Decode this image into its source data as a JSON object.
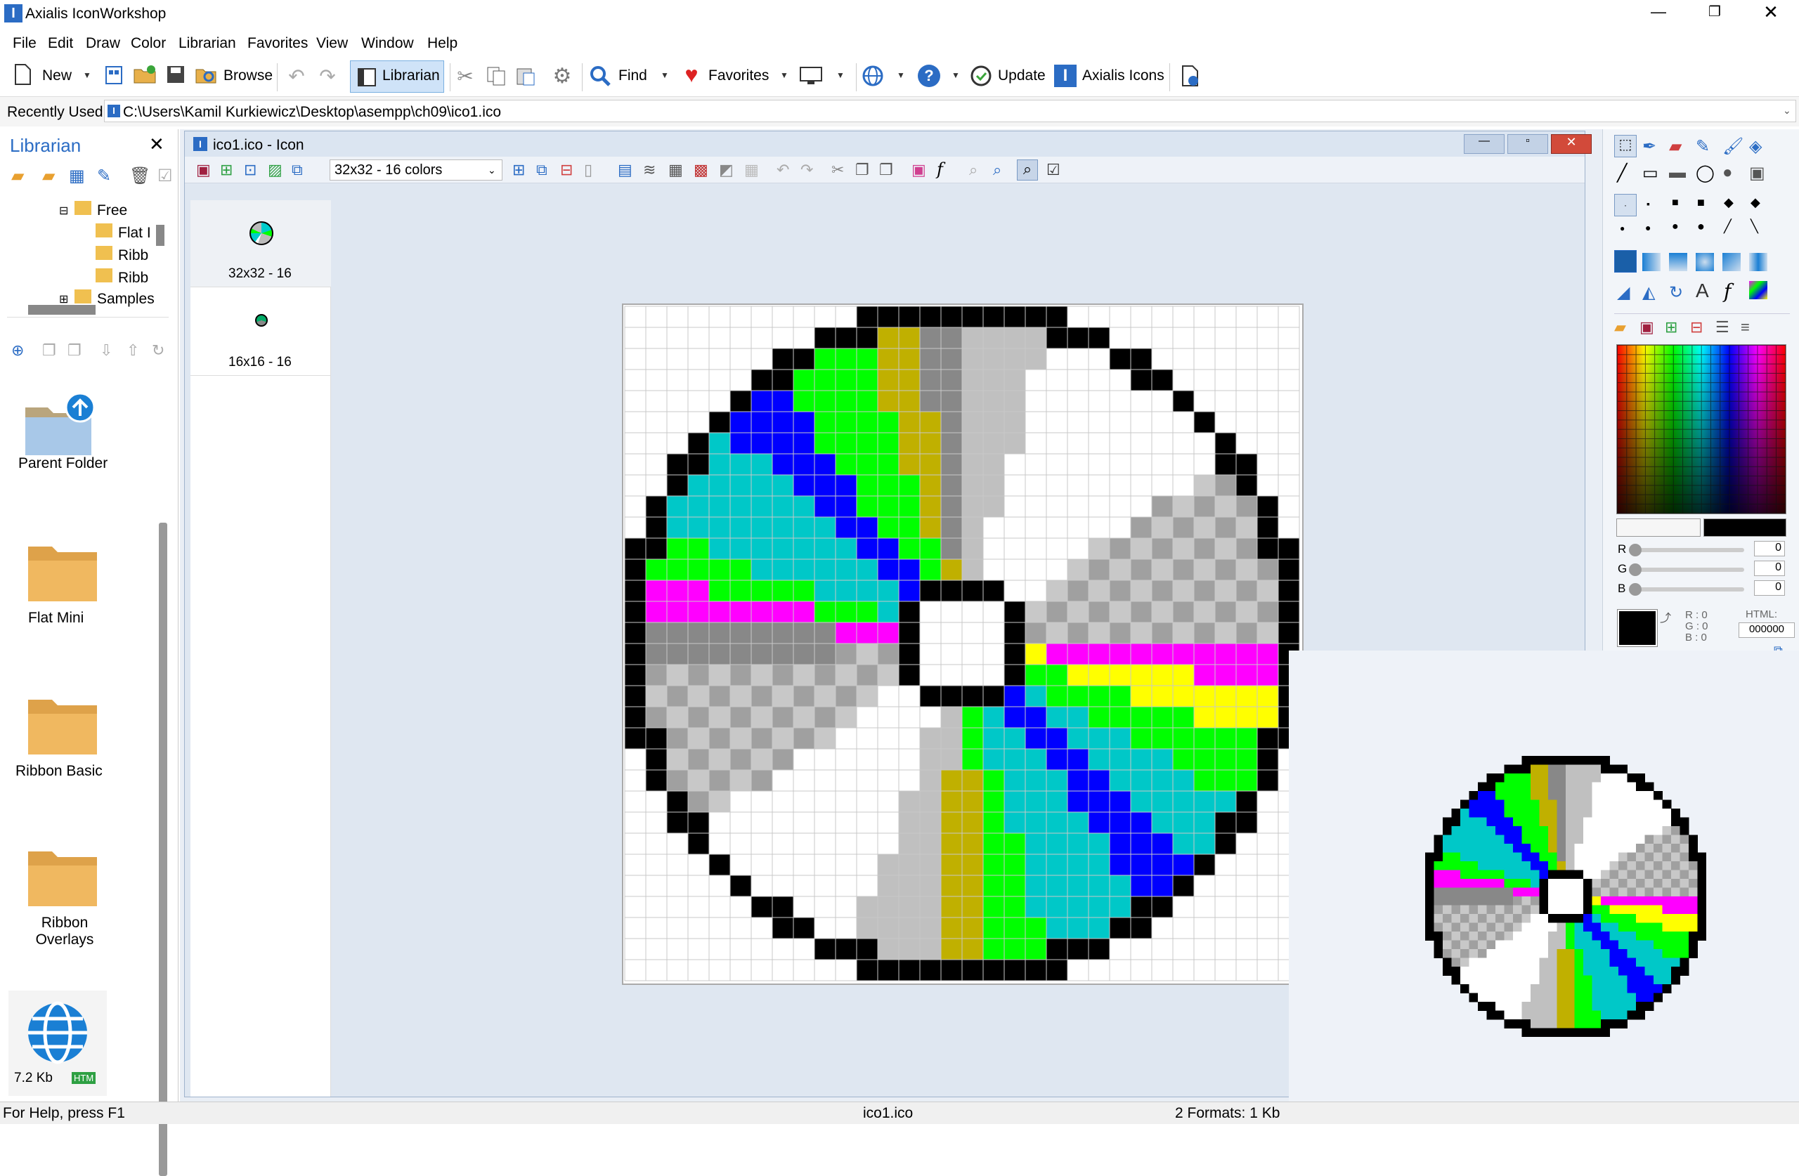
{
  "window": {
    "title": "Axialis IconWorkshop"
  },
  "menu": [
    "File",
    "Edit",
    "Draw",
    "Color",
    "Librarian",
    "Favorites",
    "View",
    "Window",
    "Help"
  ],
  "toolbar": {
    "new_label": "New",
    "browse_label": "Browse",
    "librarian_label": "Librarian",
    "find_label": "Find",
    "favorites_label": "Favorites",
    "update_label": "Update",
    "axialis_icons_label": "Axialis Icons"
  },
  "address": {
    "label": "Recently Used",
    "path": "C:\\Users\\Kamil Kurkiewicz\\Desktop\\asempp\\ch09\\ico1.ico"
  },
  "librarian": {
    "title": "Librarian",
    "tree": [
      {
        "label": "Free"
      },
      {
        "label": "Flat I"
      },
      {
        "label": "Ribb"
      },
      {
        "label": "Ribb"
      },
      {
        "label": "Samples"
      }
    ],
    "items": [
      {
        "label": "Parent Folder"
      },
      {
        "label": "Flat Mini"
      },
      {
        "label": "Ribbon Basic"
      },
      {
        "label": "Ribbon Overlays"
      },
      {
        "label": "7.2 Kb",
        "badge": "HTM"
      }
    ]
  },
  "iconwindow": {
    "title": "ico1.ico - Icon",
    "format_select": "32x32 - 16 colors",
    "formats": [
      {
        "label": "32x32 - 16"
      },
      {
        "label": "16x16 - 16"
      }
    ]
  },
  "colors": {
    "r_label": "R",
    "g_label": "G",
    "b_label": "B",
    "r_value": "0",
    "g_value": "0",
    "b_value": "0",
    "r_info": "R : 0",
    "g_info": "G : 0",
    "b_info": "B : 0",
    "html_label": "HTML:",
    "html_value": "000000"
  },
  "status": {
    "help": "For Help, press F1",
    "file": "ico1.ico",
    "formats": "2 Formats: 1 Kb"
  }
}
